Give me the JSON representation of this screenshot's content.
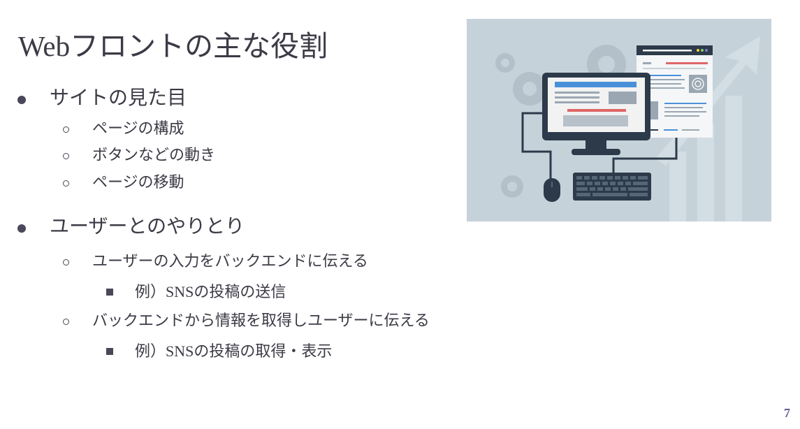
{
  "slide": {
    "title_latin": "Web",
    "title_rest": "フロントの主な役割",
    "page_number": "7",
    "sections": [
      {
        "label": "サイトの見た目",
        "items": [
          {
            "label": "ページの構成"
          },
          {
            "label": "ボタンなどの動き"
          },
          {
            "label": "ページの移動"
          }
        ]
      },
      {
        "label": "ユーザーとのやりとり",
        "items": [
          {
            "label": "ユーザーの入力をバックエンドに伝える",
            "sub": {
              "prefix": "例）",
              "latin": "SNS",
              "rest": "の投稿の送信"
            }
          },
          {
            "label": "バックエンドから情報を取得しユーザーに伝える",
            "sub": {
              "prefix": "例）",
              "latin": "SNS",
              "rest": "の投稿の取得・表示"
            }
          }
        ]
      }
    ]
  },
  "illustration": {
    "icons": [
      "gear-icon",
      "monitor-icon",
      "webpage-icon",
      "keyboard-icon",
      "mouse-icon",
      "arrow-icon"
    ],
    "colors": {
      "background": "#c6d2da",
      "dark": "#2c3a4a",
      "blue": "#4a90d9",
      "red": "#e06666",
      "light": "#f2f2f2"
    }
  }
}
